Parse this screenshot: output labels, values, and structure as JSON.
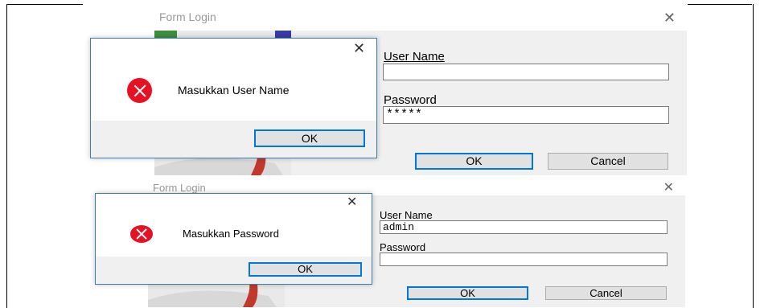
{
  "screenshot1": {
    "window_title": "Form Login",
    "username_label": "User Name",
    "username_value": "",
    "password_label": "Password",
    "password_value": "*****",
    "ok_label": "OK",
    "cancel_label": "Cancel",
    "dialog": {
      "message": "Masukkan User Name",
      "ok_label": "OK",
      "close_glyph": "✕"
    },
    "close_glyph": "✕"
  },
  "screenshot2": {
    "window_title": "Form Login",
    "username_label": "User Name",
    "username_value": "admin",
    "password_label": "Password",
    "password_value": "",
    "ok_label": "OK",
    "cancel_label": "Cancel",
    "dialog": {
      "message": "Masukkan Password",
      "ok_label": "OK",
      "close_glyph": "✕"
    },
    "close_glyph": "✕"
  },
  "colors": {
    "error_icon": "#e81123",
    "focus_border": "#0078d7",
    "window_bg": "#f0f0f0"
  },
  "icons": [
    "error-icon",
    "close-icon"
  ]
}
